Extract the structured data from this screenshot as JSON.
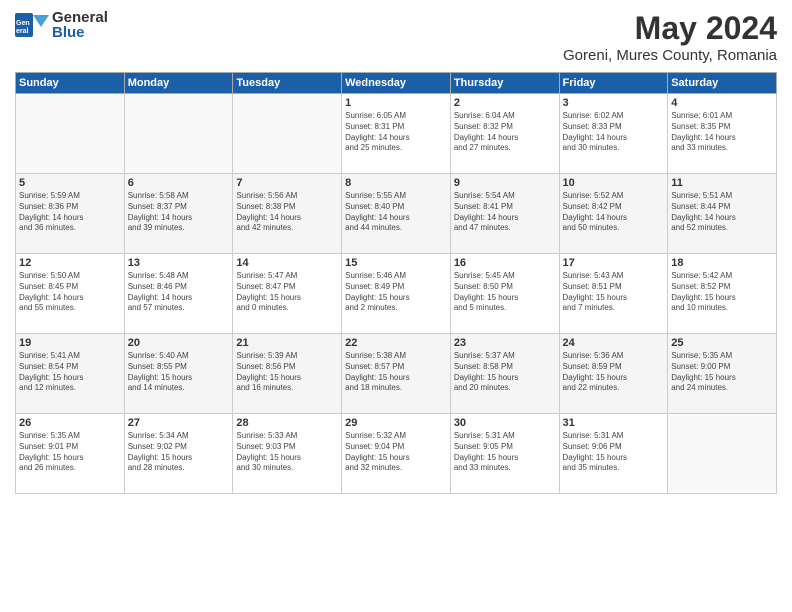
{
  "header": {
    "logo_general": "General",
    "logo_blue": "Blue",
    "month_title": "May 2024",
    "location": "Goreni, Mures County, Romania"
  },
  "days_of_week": [
    "Sunday",
    "Monday",
    "Tuesday",
    "Wednesday",
    "Thursday",
    "Friday",
    "Saturday"
  ],
  "weeks": [
    [
      {
        "day": "",
        "info": ""
      },
      {
        "day": "",
        "info": ""
      },
      {
        "day": "",
        "info": ""
      },
      {
        "day": "1",
        "info": "Sunrise: 6:05 AM\nSunset: 8:31 PM\nDaylight: 14 hours\nand 25 minutes."
      },
      {
        "day": "2",
        "info": "Sunrise: 6:04 AM\nSunset: 8:32 PM\nDaylight: 14 hours\nand 27 minutes."
      },
      {
        "day": "3",
        "info": "Sunrise: 6:02 AM\nSunset: 8:33 PM\nDaylight: 14 hours\nand 30 minutes."
      },
      {
        "day": "4",
        "info": "Sunrise: 6:01 AM\nSunset: 8:35 PM\nDaylight: 14 hours\nand 33 minutes."
      }
    ],
    [
      {
        "day": "5",
        "info": "Sunrise: 5:59 AM\nSunset: 8:36 PM\nDaylight: 14 hours\nand 36 minutes."
      },
      {
        "day": "6",
        "info": "Sunrise: 5:58 AM\nSunset: 8:37 PM\nDaylight: 14 hours\nand 39 minutes."
      },
      {
        "day": "7",
        "info": "Sunrise: 5:56 AM\nSunset: 8:38 PM\nDaylight: 14 hours\nand 42 minutes."
      },
      {
        "day": "8",
        "info": "Sunrise: 5:55 AM\nSunset: 8:40 PM\nDaylight: 14 hours\nand 44 minutes."
      },
      {
        "day": "9",
        "info": "Sunrise: 5:54 AM\nSunset: 8:41 PM\nDaylight: 14 hours\nand 47 minutes."
      },
      {
        "day": "10",
        "info": "Sunrise: 5:52 AM\nSunset: 8:42 PM\nDaylight: 14 hours\nand 50 minutes."
      },
      {
        "day": "11",
        "info": "Sunrise: 5:51 AM\nSunset: 8:44 PM\nDaylight: 14 hours\nand 52 minutes."
      }
    ],
    [
      {
        "day": "12",
        "info": "Sunrise: 5:50 AM\nSunset: 8:45 PM\nDaylight: 14 hours\nand 55 minutes."
      },
      {
        "day": "13",
        "info": "Sunrise: 5:48 AM\nSunset: 8:46 PM\nDaylight: 14 hours\nand 57 minutes."
      },
      {
        "day": "14",
        "info": "Sunrise: 5:47 AM\nSunset: 8:47 PM\nDaylight: 15 hours\nand 0 minutes."
      },
      {
        "day": "15",
        "info": "Sunrise: 5:46 AM\nSunset: 8:49 PM\nDaylight: 15 hours\nand 2 minutes."
      },
      {
        "day": "16",
        "info": "Sunrise: 5:45 AM\nSunset: 8:50 PM\nDaylight: 15 hours\nand 5 minutes."
      },
      {
        "day": "17",
        "info": "Sunrise: 5:43 AM\nSunset: 8:51 PM\nDaylight: 15 hours\nand 7 minutes."
      },
      {
        "day": "18",
        "info": "Sunrise: 5:42 AM\nSunset: 8:52 PM\nDaylight: 15 hours\nand 10 minutes."
      }
    ],
    [
      {
        "day": "19",
        "info": "Sunrise: 5:41 AM\nSunset: 8:54 PM\nDaylight: 15 hours\nand 12 minutes."
      },
      {
        "day": "20",
        "info": "Sunrise: 5:40 AM\nSunset: 8:55 PM\nDaylight: 15 hours\nand 14 minutes."
      },
      {
        "day": "21",
        "info": "Sunrise: 5:39 AM\nSunset: 8:56 PM\nDaylight: 15 hours\nand 16 minutes."
      },
      {
        "day": "22",
        "info": "Sunrise: 5:38 AM\nSunset: 8:57 PM\nDaylight: 15 hours\nand 18 minutes."
      },
      {
        "day": "23",
        "info": "Sunrise: 5:37 AM\nSunset: 8:58 PM\nDaylight: 15 hours\nand 20 minutes."
      },
      {
        "day": "24",
        "info": "Sunrise: 5:36 AM\nSunset: 8:59 PM\nDaylight: 15 hours\nand 22 minutes."
      },
      {
        "day": "25",
        "info": "Sunrise: 5:35 AM\nSunset: 9:00 PM\nDaylight: 15 hours\nand 24 minutes."
      }
    ],
    [
      {
        "day": "26",
        "info": "Sunrise: 5:35 AM\nSunset: 9:01 PM\nDaylight: 15 hours\nand 26 minutes."
      },
      {
        "day": "27",
        "info": "Sunrise: 5:34 AM\nSunset: 9:02 PM\nDaylight: 15 hours\nand 28 minutes."
      },
      {
        "day": "28",
        "info": "Sunrise: 5:33 AM\nSunset: 9:03 PM\nDaylight: 15 hours\nand 30 minutes."
      },
      {
        "day": "29",
        "info": "Sunrise: 5:32 AM\nSunset: 9:04 PM\nDaylight: 15 hours\nand 32 minutes."
      },
      {
        "day": "30",
        "info": "Sunrise: 5:31 AM\nSunset: 9:05 PM\nDaylight: 15 hours\nand 33 minutes."
      },
      {
        "day": "31",
        "info": "Sunrise: 5:31 AM\nSunset: 9:06 PM\nDaylight: 15 hours\nand 35 minutes."
      },
      {
        "day": "",
        "info": ""
      }
    ]
  ]
}
